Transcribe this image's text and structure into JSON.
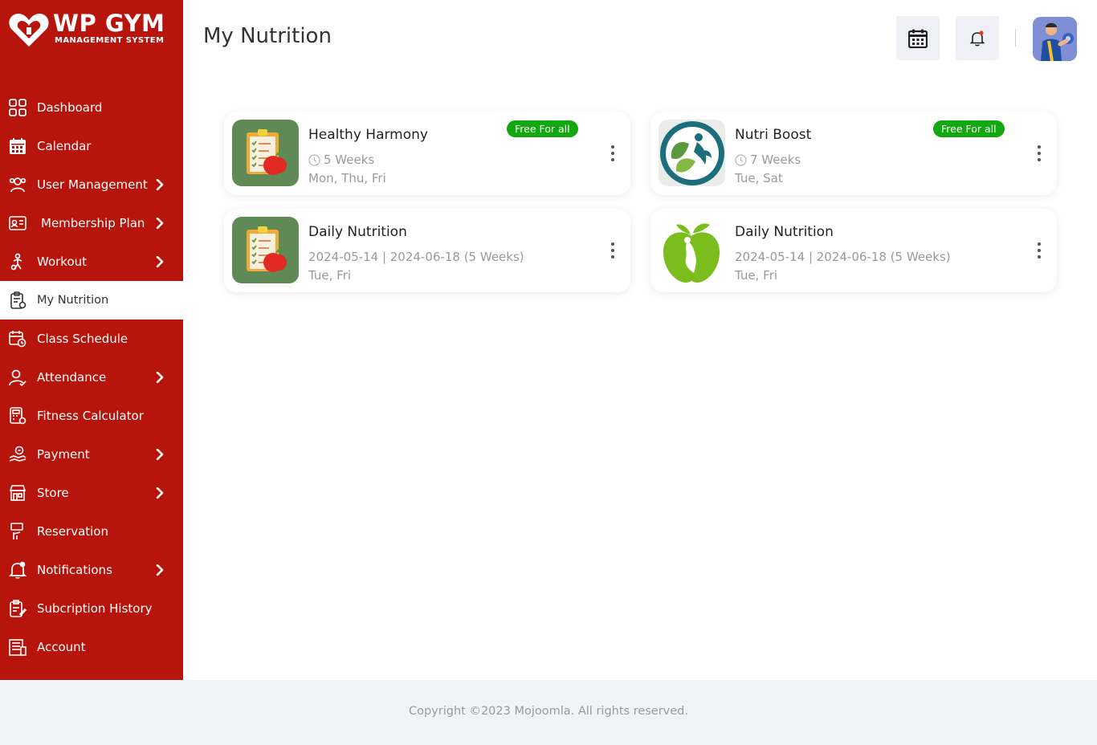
{
  "brand": {
    "title": "WP GYM",
    "subtitle": "MANAGEMENT SYSTEM",
    "colors": {
      "sidebar": "#b7150c",
      "badge": "#12a80f",
      "footer": "#f1f3f8"
    }
  },
  "sidebar": {
    "items": [
      {
        "label": "Dashboard",
        "icon": "grid-icon",
        "has_submenu": false,
        "active": false
      },
      {
        "label": "Calendar",
        "icon": "calendar-icon",
        "has_submenu": false,
        "active": false
      },
      {
        "label": "User Management",
        "icon": "users-icon",
        "has_submenu": true,
        "active": false
      },
      {
        "label": "Membership Plan",
        "icon": "id-card-icon",
        "has_submenu": true,
        "active": false
      },
      {
        "label": "Workout",
        "icon": "workout-icon",
        "has_submenu": true,
        "active": false
      },
      {
        "label": "My Nutrition",
        "icon": "clipboard-icon",
        "has_submenu": false,
        "active": true
      },
      {
        "label": "Class Schedule",
        "icon": "schedule-icon",
        "has_submenu": false,
        "active": false
      },
      {
        "label": "Attendance",
        "icon": "user-check-icon",
        "has_submenu": true,
        "active": false
      },
      {
        "label": "Fitness Calculator",
        "icon": "calculator-icon",
        "has_submenu": false,
        "active": false
      },
      {
        "label": "Payment",
        "icon": "payment-icon",
        "has_submenu": true,
        "active": false
      },
      {
        "label": "Store",
        "icon": "store-icon",
        "has_submenu": true,
        "active": false
      },
      {
        "label": "Reservation",
        "icon": "reservation-icon",
        "has_submenu": false,
        "active": false
      },
      {
        "label": "Notifications",
        "icon": "bell-icon",
        "has_submenu": true,
        "active": false
      },
      {
        "label": "Subcription History",
        "icon": "history-icon",
        "has_submenu": false,
        "active": false
      },
      {
        "label": "Account",
        "icon": "account-icon",
        "has_submenu": false,
        "active": false
      }
    ]
  },
  "header": {
    "title": "My Nutrition",
    "calendar_icon": "calendar-icon",
    "bell_icon": "bell-icon"
  },
  "cards": [
    {
      "name": "Healthy Harmony",
      "badge": "Free For all",
      "duration": "5 Weeks",
      "days": "Mon, Thu, Fri",
      "thumb": "clipboard-apple"
    },
    {
      "name": "Nutri Boost",
      "badge": "Free For all",
      "duration": "7 Weeks",
      "days": "Tue, Sat",
      "thumb": "leaf-person"
    },
    {
      "name": "Daily Nutrition",
      "badge": "",
      "duration": "2024-05-14 | 2024-06-18 (5 Weeks)",
      "days": "Tue, Fri",
      "thumb": "clipboard-apple"
    },
    {
      "name": "Daily Nutrition",
      "badge": "",
      "duration": "2024-05-14 | 2024-06-18 (5 Weeks)",
      "days": "Tue, Fri",
      "thumb": "green-apple"
    }
  ],
  "footer": {
    "copyright": "Copyright ©2023 Mojoomla. All rights reserved."
  }
}
